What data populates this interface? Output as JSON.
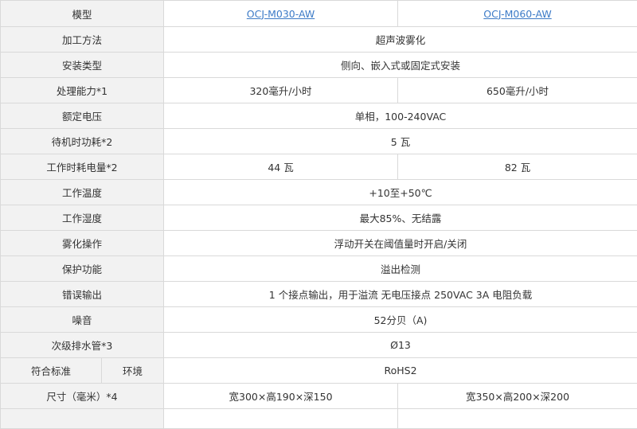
{
  "header": {
    "label": "模型",
    "models": [
      "OCJ-M030-AW",
      "OCJ-M060-AW"
    ]
  },
  "rows": {
    "method": {
      "label": "加工方法",
      "value": "超声波雾化"
    },
    "install": {
      "label": "安装类型",
      "value": "侧向、嵌入式或固定式安装"
    },
    "capacity": {
      "label": "处理能力*1",
      "values": [
        "320毫升/小时",
        "650毫升/小时"
      ]
    },
    "voltage": {
      "label": "额定电压",
      "value": "单相，100-240VAC"
    },
    "standby": {
      "label": "待机时功耗*2",
      "value": "5 瓦"
    },
    "working_power": {
      "label": "工作时耗电量*2",
      "values": [
        "44 瓦",
        "82 瓦"
      ]
    },
    "temp": {
      "label": "工作温度",
      "value": "+10至+50℃"
    },
    "humidity": {
      "label": "工作湿度",
      "value": "最大85%、无结露"
    },
    "operation": {
      "label": "雾化操作",
      "value": "浮动开关在阈值量时开启/关闭"
    },
    "protection": {
      "label": "保护功能",
      "value": "溢出检测"
    },
    "error_out": {
      "label": "错误输出",
      "value": "1 个接点输出，用于溢流 无电压接点 250VAC 3A 电阻负载"
    },
    "noise": {
      "label": "噪音",
      "value": "52分贝（A)"
    },
    "drain": {
      "label": "次级排水管*3",
      "value": "Ø13"
    },
    "compliance": {
      "label": "符合标准",
      "sublabel": "环境",
      "value": "RoHS2"
    },
    "size": {
      "label": "尺寸（毫米）*4",
      "values": [
        "宽300×高190×深150",
        "宽350×高200×深200"
      ]
    }
  }
}
